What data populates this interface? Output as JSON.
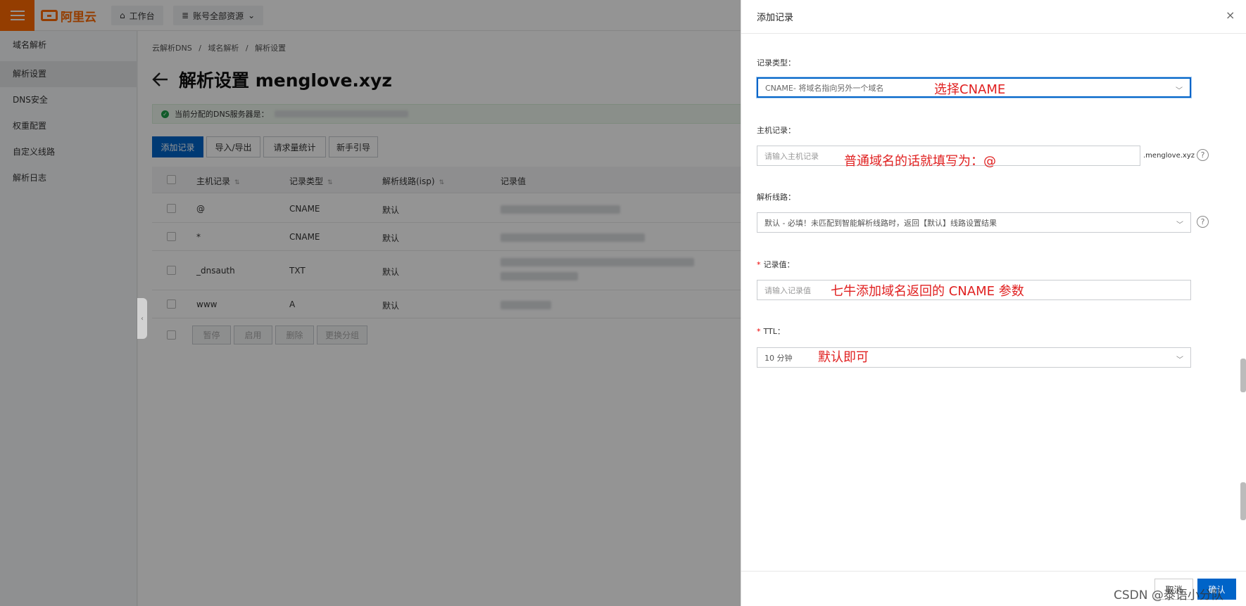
{
  "topbar": {
    "logo_text": "阿里云",
    "workbench_label": "工作台",
    "resources_label": "账号全部资源"
  },
  "sidebar": {
    "items": [
      {
        "label": "域名解析"
      },
      {
        "label": "解析设置"
      },
      {
        "label": "DNS安全"
      },
      {
        "label": "权重配置"
      },
      {
        "label": "自定义线路"
      },
      {
        "label": "解析日志"
      }
    ]
  },
  "main": {
    "breadcrumb": [
      "云解析DNS",
      "域名解析",
      "解析设置"
    ],
    "breadcrumb_sep": "/",
    "title": "解析设置 menglove.xyz",
    "notice": "当前分配的DNS服务器是：",
    "buttons": {
      "add": "添加记录",
      "import_export": "导入/导出",
      "stats": "请求量统计",
      "guide": "新手引导"
    },
    "table": {
      "headers": [
        "主机记录",
        "记录类型",
        "解析线路(isp)",
        "记录值"
      ],
      "rows": [
        {
          "host": "@",
          "type": "CNAME",
          "line": "默认"
        },
        {
          "host": "*",
          "type": "CNAME",
          "line": "默认"
        },
        {
          "host": "_dnsauth",
          "type": "TXT",
          "line": "默认"
        },
        {
          "host": "www",
          "type": "A",
          "line": "默认"
        }
      ]
    },
    "footer_buttons": [
      "暂停",
      "启用",
      "删除",
      "更换分组"
    ]
  },
  "drawer": {
    "title": "添加记录",
    "close": "×",
    "fields": {
      "record_type": {
        "label": "记录类型：",
        "value": "CNAME- 将域名指向另外一个域名"
      },
      "host": {
        "label": "主机记录：",
        "placeholder": "请输入主机记录",
        "suffix": ".menglove.xyz"
      },
      "line": {
        "label": "解析线路：",
        "value": "默认 - 必填！未匹配到智能解析线路时，返回【默认】线路设置结果"
      },
      "value": {
        "label": "记录值：",
        "placeholder": "请输入记录值"
      },
      "ttl": {
        "label": "TTL：",
        "value": "10 分钟"
      }
    },
    "help_glyph": "?",
    "chevron": "﹀",
    "footer": {
      "cancel": "取消",
      "ok": "确认"
    }
  },
  "annotations": {
    "record_type": "选择CNAME",
    "host": "普通域名的话就填写为：@",
    "value": "七牛添加域名返回的 CNAME 参数",
    "ttl": "默认即可"
  },
  "watermark": "CSDN @泰语小分队",
  "colors": {
    "brand": "#ff6a00",
    "primary": "#0064c8",
    "annotation": "#e02020",
    "success": "#1e9e49"
  }
}
